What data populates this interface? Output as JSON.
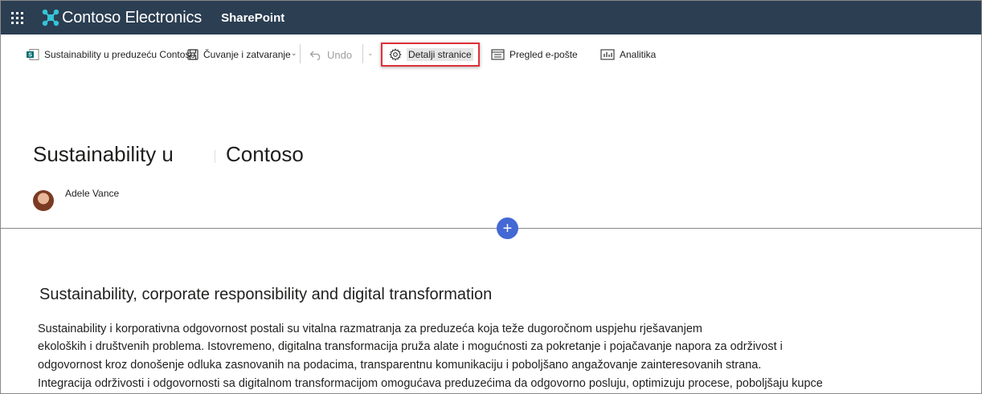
{
  "suite": {
    "brand_name": "Contoso Electronics",
    "app_name": "SharePoint",
    "bar_color": "#2b3e52"
  },
  "commandbar": {
    "page_name": "Sustainability u preduzeću Contoso",
    "save_close": "Čuvanje i zatvaranje",
    "undo": "Undo",
    "page_details": "Detalji stranice",
    "email_preview": "Pregled e-pošte",
    "analytics": "Analitika"
  },
  "page": {
    "title_part1": "Sustainability u",
    "title_part2": "Contoso",
    "author": "Adele Vance"
  },
  "content": {
    "heading": "Sustainability, corporate responsibility and digital transformation",
    "lines": [
      "Sustainability i korporativna odgovornost postali su vitalna razmatranja za preduzeća koja teže dugoročnom uspjehu rješavanjem",
      "ekoloških i društvenih problema. Istovremeno, digitalna transformacija pruža alate i mogućnosti za pokretanje i pojačavanje napora za održivost i",
      "odgovornost kroz donošenje odluka zasnovanih na podacima, transparentnu komunikaciju i poboljšano angažovanje zainteresovanih strana.",
      "Integracija održivosti i odgovornosti sa digitalnom transformacijom omogućava preduzećima da odgovorno posluju, optimizuju procese, poboljšaju kupce"
    ]
  },
  "colors": {
    "accent_button": "#4468d4",
    "highlight_border": "#e0303a"
  }
}
